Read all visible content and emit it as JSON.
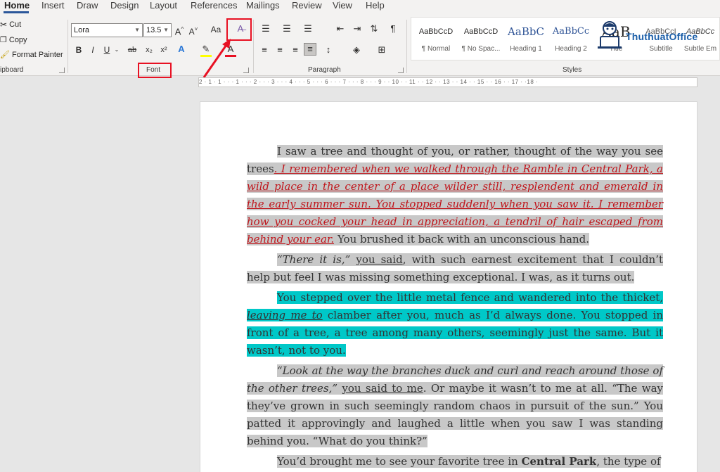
{
  "tabs": [
    "Home",
    "Insert",
    "Draw",
    "Design",
    "Layout",
    "References",
    "Mailings",
    "Review",
    "View",
    "Help"
  ],
  "clipboard": {
    "cut": "Cut",
    "copy": "Copy",
    "format_painter": "Format Painter",
    "label": "ipboard"
  },
  "font": {
    "family": "Lora",
    "size": "13.5",
    "label": "Font",
    "buttons": [
      "B",
      "I",
      "U",
      "ab",
      "x₂",
      "x²"
    ],
    "grow": "A^",
    "shrink": "A˅",
    "case": "Aa"
  },
  "paragraph": {
    "label": "Paragraph"
  },
  "styles": {
    "label": "Styles",
    "items": [
      {
        "preview": "AaBbCcD",
        "name": "¶ Normal"
      },
      {
        "preview": "AaBbCcD",
        "name": "¶ No Spac..."
      },
      {
        "preview": "AaBbC",
        "name": "Heading 1"
      },
      {
        "preview": "AaBbCc",
        "name": "Heading 2"
      },
      {
        "preview": "AaB",
        "name": "Title"
      },
      {
        "preview": "AaBbCcI",
        "name": "Subtitle"
      },
      {
        "preview": "AaBbCc",
        "name": "Subtle Em"
      }
    ]
  },
  "logo": {
    "text": "ThuthuatOffice",
    "sub": "TỔNG HỢP TIN HỌC VĂN PHÒNG"
  },
  "ruler": {
    "marks": "2 · 1 · 1 · · · 1 · · · 2 · · · 3 · · · 4 · · · 5 · · · 6 · · · 7 · · · 8 · · · 9 · · 10 · · 11 · · 12 · · 13 · · 14 · · 15 · · 16 · · 17 · ·18 ·"
  },
  "doc": {
    "p1a": "I saw a tree and thought of you, or rather, thought of the way you see trees",
    "p1b": ". I remembered when we walked through the Ramble in Central Park, a wild place in the center of a place wilder still, resplendent and emerald in the early summer sun. You stopped suddenly when you saw it. I remember how you cocked your head in appreciation, a tendril of hair escaped from behind your ear.",
    "p1c": " You brushed it back with an unconscious hand.",
    "p2a": "“There it is,”",
    "p2b": " ",
    "p2c": "you said",
    "p2d": ", with such earnest excitement that I couldn’t help but feel I was missing something exceptional. I was, as it turns out.",
    "p3a": "You stepped over the little metal fence and wandered into the thicket, ",
    "p3b": "leaving me to",
    "p3c": " clamber after you, much as I’d always done. You stopped in front of a tree, a tree among many others, seemingly just the same. But it wasn’t, not to you.",
    "p4a": "“Look at the way the branches duck and curl and reach around those of the other trees,”",
    "p4b": " ",
    "p4c": "you said to me",
    "p4d": ". Or maybe it wasn’t to me at all. “The way they’ve grown in such seemingly random chaos in pursuit of the sun.” You patted it approvingly and laughed a little when you saw I was standing behind you. “What do you think?”",
    "p5a": "You’d brought me to see your favorite tree in ",
    "p5b": "Central Park",
    "p5c": ", the type of"
  }
}
